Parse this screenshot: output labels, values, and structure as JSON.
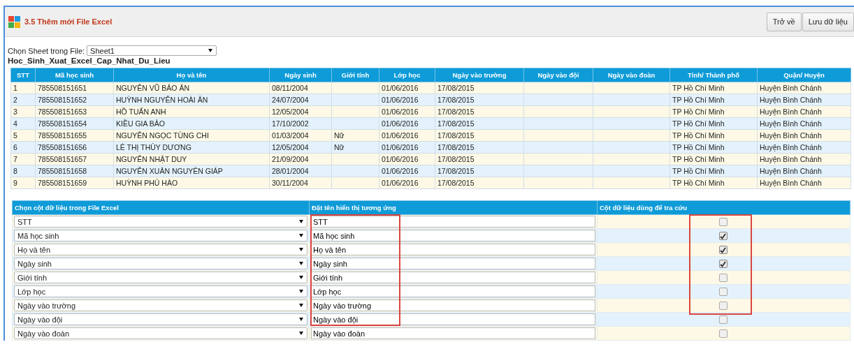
{
  "header": {
    "title": "3.5 Thêm mới File Excel",
    "buttons": [
      "Trở về",
      "Lưu dữ liệu"
    ]
  },
  "sheet": {
    "label": "Chọn Sheet trong File:",
    "value": "Sheet1"
  },
  "file_name": "Hoc_Sinh_Xuat_Excel_Cap_Nhat_Du_Lieu",
  "preview_table": {
    "columns": [
      "STT",
      "Mã học sinh",
      "Họ và tên",
      "Ngày sinh",
      "Giới tính",
      "Lớp học",
      "Ngày vào trường",
      "Ngày vào đội",
      "Ngày vào đoàn",
      "Tỉnh/ Thành phố",
      "Quận/ Huyện"
    ],
    "rows": [
      [
        "1",
        "785508151651",
        "NGUYỄN VŨ BẢO ÂN",
        "08/11/2004",
        "",
        "01/06/2016",
        "17/08/2015",
        "",
        "",
        "TP Hồ Chí Minh",
        "Huyện Bình Chánh"
      ],
      [
        "2",
        "785508151652",
        "HUỲNH NGUYỄN HOÀI ÂN",
        "24/07/2004",
        "",
        "01/06/2016",
        "17/08/2015",
        "",
        "",
        "TP Hồ Chí Minh",
        "Huyện Bình Chánh"
      ],
      [
        "3",
        "785508151653",
        "HỒ TUẤN ANH",
        "12/05/2004",
        "",
        "01/06/2016",
        "17/08/2015",
        "",
        "",
        "TP Hồ Chí Minh",
        "Huyện Bình Chánh"
      ],
      [
        "4",
        "785508151654",
        "KIỀU GIA BẢO",
        "17/10/2002",
        "",
        "01/06/2016",
        "17/08/2015",
        "",
        "",
        "TP Hồ Chí Minh",
        "Huyện Bình Chánh"
      ],
      [
        "5",
        "785508151655",
        "NGUYỄN NGỌC TÙNG CHI",
        "01/03/2004",
        "Nữ",
        "01/06/2016",
        "17/08/2015",
        "",
        "",
        "TP Hồ Chí Minh",
        "Huyện Bình Chánh"
      ],
      [
        "6",
        "785508151656",
        "LÊ THỊ THÙY DƯƠNG",
        "12/05/2004",
        "Nữ",
        "01/06/2016",
        "17/08/2015",
        "",
        "",
        "TP Hồ Chí Minh",
        "Huyện Bình Chánh"
      ],
      [
        "7",
        "785508151657",
        "NGUYỄN NHẬT DUY",
        "21/09/2004",
        "",
        "01/06/2016",
        "17/08/2015",
        "",
        "",
        "TP Hồ Chí Minh",
        "Huyện Bình Chánh"
      ],
      [
        "8",
        "785508151658",
        "NGUYỄN XUÂN NGUYÊN GIÁP",
        "28/01/2004",
        "",
        "01/06/2016",
        "17/08/2015",
        "",
        "",
        "TP Hồ Chí Minh",
        "Huyện Bình Chánh"
      ],
      [
        "9",
        "785508151659",
        "HUỲNH PHÚ HÀO",
        "30/11/2004",
        "",
        "01/06/2016",
        "17/08/2015",
        "",
        "",
        "TP Hồ Chí Minh",
        "Huyện Bình Chánh"
      ]
    ]
  },
  "mapping_table": {
    "columns": [
      "Chọn cột dữ liệu trong File Excel",
      "Đặt tên hiển thị tương ứng",
      "Cột dữ liệu dùng để tra cứu"
    ],
    "rows": [
      {
        "source": "STT",
        "display_name": "STT",
        "checked": false
      },
      {
        "source": "Mã học sinh",
        "display_name": "Mã học sinh",
        "checked": true
      },
      {
        "source": "Họ và tên",
        "display_name": "Họ và tên",
        "checked": true
      },
      {
        "source": "Ngày sinh",
        "display_name": "Ngày sinh",
        "checked": true
      },
      {
        "source": "Giới tính",
        "display_name": "Giới tính",
        "checked": false
      },
      {
        "source": "Lớp học",
        "display_name": "Lớp học",
        "checked": false
      },
      {
        "source": "Ngày vào trường",
        "display_name": "Ngày vào trường",
        "checked": false
      },
      {
        "source": "Ngày vào đội",
        "display_name": "Ngày vào đội",
        "checked": false
      },
      {
        "source": "Ngày vào đoàn",
        "display_name": "Ngày vào đoàn",
        "checked": false
      }
    ]
  }
}
